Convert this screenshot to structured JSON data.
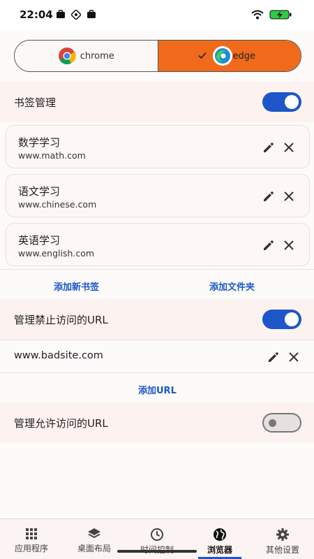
{
  "status_bar": {
    "time": "22:04"
  },
  "browser_switch": {
    "options": [
      {
        "label": "chrome",
        "selected": false
      },
      {
        "label": "edge",
        "selected": true
      }
    ],
    "colors": {
      "selected": "#f06a1c"
    }
  },
  "bookmarks": {
    "title": "书签管理",
    "enabled": true,
    "items": [
      {
        "title": "数学学习",
        "url": "www.math.com"
      },
      {
        "title": "语文学习",
        "url": "www.chinese.com"
      },
      {
        "title": "英语学习",
        "url": "www.english.com"
      }
    ],
    "add_bookmark": "添加新书签",
    "add_folder": "添加文件夹"
  },
  "blocked": {
    "title": "管理禁止访问的URL",
    "enabled": true,
    "items": [
      {
        "url": "www.badsite.com"
      }
    ],
    "add": "添加URL"
  },
  "allowed": {
    "title": "管理允许访问的URL",
    "enabled": false
  },
  "nav": {
    "items": [
      {
        "label": "应用程序",
        "icon": "grid-icon"
      },
      {
        "label": "桌面布局",
        "icon": "layers-icon"
      },
      {
        "label": "时间控制",
        "icon": "clock-icon"
      },
      {
        "label": "浏览器",
        "icon": "globe-icon",
        "active": true
      },
      {
        "label": "其他设置",
        "icon": "gear-icon"
      }
    ],
    "accent": "#1d56c9"
  }
}
